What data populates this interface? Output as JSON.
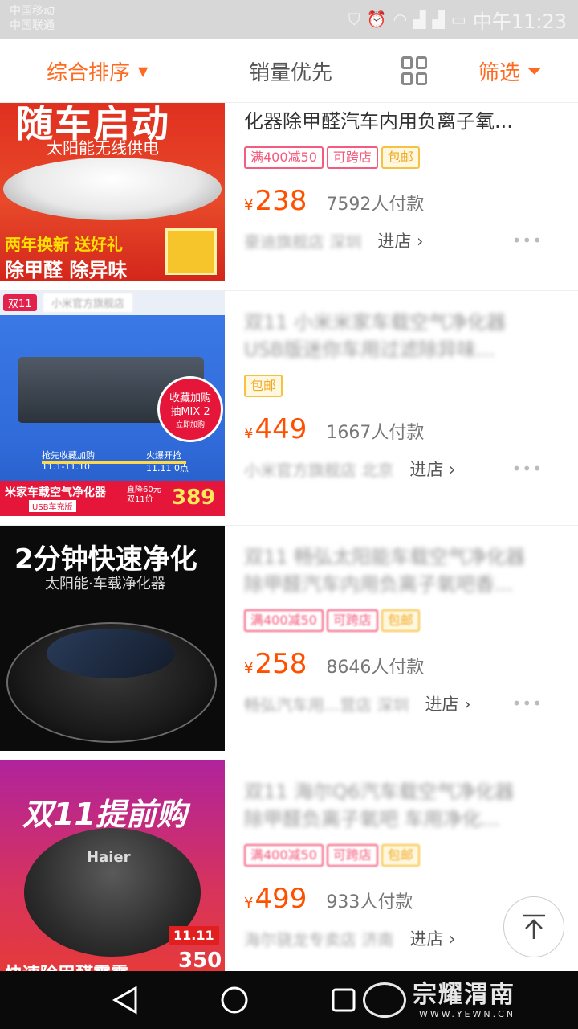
{
  "status_bar": {
    "carrier_1": "中国移动",
    "carrier_2": "中国联通",
    "time": "中午11:23",
    "icons": [
      "shield-icon",
      "alarm-icon",
      "wifi-icon",
      "signal-icon",
      "signal-icon",
      "battery-icon"
    ]
  },
  "sort_bar": {
    "comprehensive": "综合排序",
    "sales_first": "销量优先",
    "filter": "筛选"
  },
  "products": [
    {
      "image_text": {
        "big": "随车启动",
        "sub": "太阳能无线供电",
        "line1": "两年换新 送好礼",
        "line2": "除甲醛 除异味"
      },
      "title_lines": [
        "化器除甲醛汽车内用负离子氧..."
      ],
      "tags": [
        "满400减50",
        "可跨店",
        "包邮"
      ],
      "price": "238",
      "paid": "7592人付款",
      "shop": "豪迪旗舰店 深圳",
      "enter": "进店"
    },
    {
      "image_text": {
        "d11": "双11",
        "brand": "小米官方旗舰店",
        "badge_1": "收藏加购",
        "badge_2": "抽MIX 2",
        "badge_3": "立即加购",
        "tl_1": "抢先收藏加购",
        "tl_1_date": "11.1-11.10",
        "tl_2": "火爆开抢",
        "tl_2_date": "11.11 0点",
        "name": "米家车载空气净化器",
        "name_sub": "USB车充版",
        "promo": "直降60元",
        "promo_sub": "双11价",
        "promo_price": "389"
      },
      "title_lines": [
        "双11 小米米家车载空气净化器",
        "USB版迷你车用过滤除异味..."
      ],
      "tags": [
        "包邮"
      ],
      "price": "449",
      "paid": "1667人付款",
      "shop": "小米官方旗舰店 北京",
      "enter": "进店"
    },
    {
      "image_text": {
        "big": "2分钟快速净化",
        "sub": "太阳能·车载净化器"
      },
      "title_lines": [
        "双11 畅弘太阳能车载空气净化器",
        "除甲醛汽车内用负离子氧吧香..."
      ],
      "tags": [
        "满400减50",
        "可跨店",
        "包邮"
      ],
      "price": "258",
      "paid": "8646人付款",
      "shop": "畅弘汽车用...营店 深圳",
      "enter": "进店"
    },
    {
      "image_text": {
        "big": "双11提前购",
        "logo": "Haier",
        "bottom": "快速除甲醛雾霾",
        "badge": "11.11",
        "price": "350"
      },
      "title_lines": [
        "双11 海尔Q6汽车载空气净化器",
        "除甲醛负离子氧吧 车用净化..."
      ],
      "tags": [
        "满400减50",
        "可跨店",
        "包邮"
      ],
      "price": "499",
      "paid": "933人付款",
      "shop": "海尔骁龙专卖店 济南",
      "enter": "进店"
    }
  ],
  "watermark": {
    "main": "宗耀渭南",
    "url": "WWW.YEWN.CN"
  }
}
